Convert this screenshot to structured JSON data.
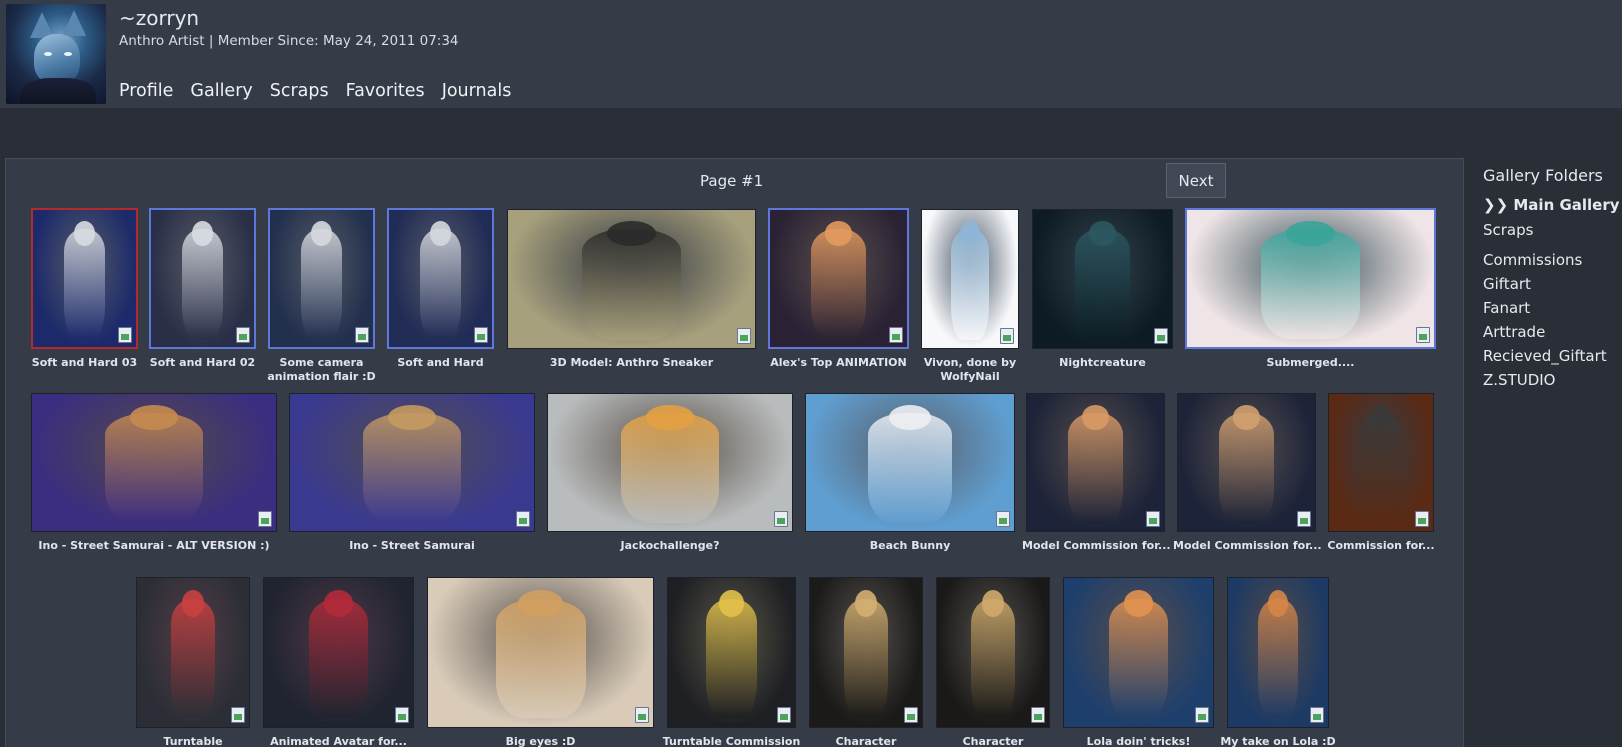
{
  "header": {
    "username": "~zorryn",
    "subtitle": "Anthro Artist | Member Since: May 24, 2011 07:34",
    "nav": [
      "Profile",
      "Gallery",
      "Scraps",
      "Favorites",
      "Journals"
    ]
  },
  "gallery": {
    "page_label": "Page #1",
    "next_label": "Next",
    "items": [
      {
        "title": "Soft and Hard 03",
        "title2": "",
        "selected": true,
        "colors": [
          "#1c2a6b",
          "#d8dbe0"
        ]
      },
      {
        "title": "Soft and Hard 02",
        "title2": "",
        "colors": [
          "#2a2f48",
          "#d9dce2"
        ]
      },
      {
        "title": "Some camera",
        "title2": "animation flair :D",
        "colors": [
          "#22304e",
          "#d6d9df"
        ]
      },
      {
        "title": "Soft and Hard",
        "title2": "",
        "colors": [
          "#202b56",
          "#d5d8de"
        ]
      },
      {
        "title": "3D Model: Anthro Sneaker",
        "title2": "",
        "colors": [
          "#a7a07d",
          "#2a2a2a"
        ]
      },
      {
        "title": "Alex's Top ANIMATION",
        "title2": "",
        "colors": [
          "#2a2234",
          "#e49a5e"
        ]
      },
      {
        "title": "Vivon, done by",
        "title2": "WolfyNail",
        "colors": [
          "#f7f8fa",
          "#8fb6d6"
        ]
      },
      {
        "title": "Nightcreature",
        "title2": "",
        "colors": [
          "#0d1c24",
          "#2c5862"
        ]
      },
      {
        "title": "Submerged....",
        "title2": "",
        "colors": [
          "#efe4e6",
          "#3aa49a"
        ]
      },
      {
        "title": "Ino - Street Samurai - ALT VERSION :)",
        "title2": "",
        "colors": [
          "#3b2d80",
          "#c48a50"
        ]
      },
      {
        "title": "Ino - Street Samurai",
        "title2": "",
        "colors": [
          "#3a3990",
          "#c49a62"
        ]
      },
      {
        "title": "Jackochallenge?",
        "title2": "",
        "colors": [
          "#b9bcbd",
          "#e3a142"
        ]
      },
      {
        "title": "Beach Bunny",
        "title2": "",
        "colors": [
          "#5f9ed0",
          "#edeef2"
        ]
      },
      {
        "title": "Model Commission for...",
        "title2": "",
        "colors": [
          "#1d2338",
          "#d89a66"
        ]
      },
      {
        "title": "Model Commission for...",
        "title2": "",
        "colors": [
          "#1d2338",
          "#d1a070"
        ]
      },
      {
        "title": "Commission for...",
        "title2": "",
        "colors": [
          "#5a2a14",
          "#3a3a3a"
        ]
      },
      {
        "title": "Turntable",
        "title2": "",
        "colors": [
          "#2b2e36",
          "#c94040"
        ]
      },
      {
        "title": "Animated Avatar for...",
        "title2": "",
        "colors": [
          "#1f2430",
          "#b22a3a"
        ]
      },
      {
        "title": "Big eyes :D",
        "title2": "",
        "colors": [
          "#d9cbb8",
          "#d1a060"
        ]
      },
      {
        "title": "Turntable Commission",
        "title2": "",
        "colors": [
          "#1e1f23",
          "#e2c14a"
        ]
      },
      {
        "title": "Character",
        "title2": "",
        "colors": [
          "#1b1a18",
          "#d4b070"
        ]
      },
      {
        "title": "Character",
        "title2": "",
        "colors": [
          "#1a1917",
          "#cfaa6a"
        ]
      },
      {
        "title": "Lola doin' tricks!",
        "title2": "",
        "colors": [
          "#1e3f6c",
          "#e29250"
        ]
      },
      {
        "title": "My take on Lola :D",
        "title2": "",
        "colors": [
          "#1d3a64",
          "#d68648"
        ]
      }
    ]
  },
  "sidebar": {
    "title": "Gallery Folders",
    "active_marker": "❯❯",
    "folders": [
      "Main Gallery",
      "Scraps",
      "Commissions",
      "Giftart",
      "Fanart",
      "Arttrade",
      "Recieved_Giftart",
      "Z.STUDIO"
    ]
  },
  "icons": {
    "file_badge": "image-file-icon",
    "avatar": "user-avatar"
  }
}
